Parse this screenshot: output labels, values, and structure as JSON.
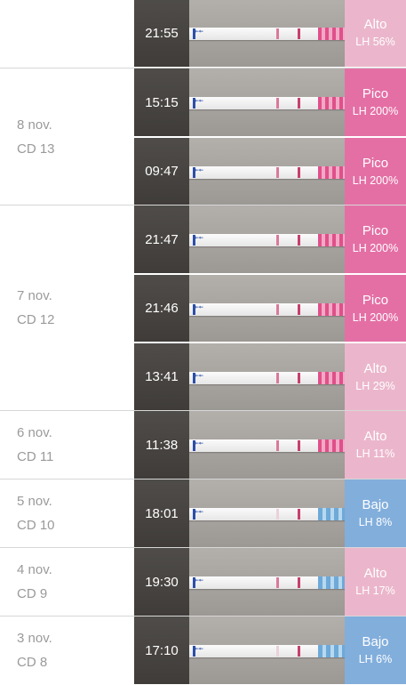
{
  "colors": {
    "alto": "#ebb6cb",
    "pico": "#e46fa5",
    "bajo": "#82aedc"
  },
  "groups": [
    {
      "date": "",
      "cd": "",
      "rows": [
        {
          "time": "21:55",
          "status": "Alto",
          "lh": "LH 56%",
          "level": "alto"
        }
      ]
    },
    {
      "date": "8 nov.",
      "cd": "CD 13",
      "rows": [
        {
          "time": "15:15",
          "status": "Pico",
          "lh": "LH 200%",
          "level": "pico"
        },
        {
          "time": "09:47",
          "status": "Pico",
          "lh": "LH 200%",
          "level": "pico"
        }
      ]
    },
    {
      "date": "7 nov.",
      "cd": "CD 12",
      "rows": [
        {
          "time": "21:47",
          "status": "Pico",
          "lh": "LH 200%",
          "level": "pico"
        },
        {
          "time": "21:46",
          "status": "Pico",
          "lh": "LH 200%",
          "level": "pico"
        },
        {
          "time": "13:41",
          "status": "Alto",
          "lh": "LH 29%",
          "level": "alto"
        }
      ]
    },
    {
      "date": "6 nov.",
      "cd": "CD 11",
      "rows": [
        {
          "time": "11:38",
          "status": "Alto",
          "lh": "LH 11%",
          "level": "alto"
        }
      ]
    },
    {
      "date": "5 nov.",
      "cd": "CD 10",
      "rows": [
        {
          "time": "18:01",
          "status": "Bajo",
          "lh": "LH 8%",
          "level": "bajo"
        }
      ]
    },
    {
      "date": "4 nov.",
      "cd": "CD 9",
      "rows": [
        {
          "time": "19:30",
          "status": "Alto",
          "lh": "LH 17%",
          "level": "alto"
        }
      ]
    },
    {
      "date": "3 nov.",
      "cd": "CD 8",
      "rows": [
        {
          "time": "17:10",
          "status": "Bajo",
          "lh": "LH 6%",
          "level": "bajo"
        }
      ]
    }
  ]
}
